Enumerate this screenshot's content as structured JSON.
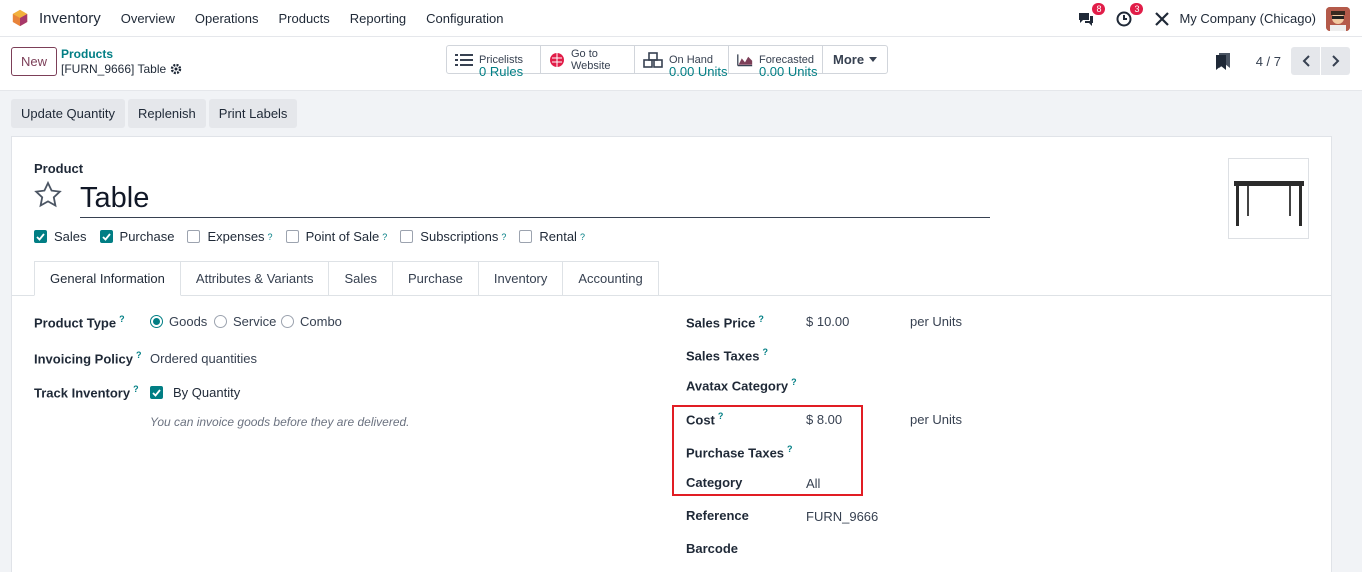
{
  "nav": {
    "app_name": "Inventory",
    "menu": [
      "Overview",
      "Operations",
      "Products",
      "Reporting",
      "Configuration"
    ],
    "chat_count": "8",
    "activity_count": "3",
    "company": "My Company (Chicago)"
  },
  "control": {
    "new_label": "New",
    "breadcrumb_parent": "Products",
    "breadcrumb_current": "[FURN_9666] Table",
    "smart_buttons": [
      {
        "line1": "Pricelists",
        "line2": "0 Rules"
      },
      {
        "line1": "Go to",
        "line2": "Website"
      },
      {
        "line1": "On Hand",
        "line2": "0.00 Units"
      },
      {
        "line1": "Forecasted",
        "line2": "0.00 Units"
      }
    ],
    "more_label": "More",
    "pager": "4 / 7"
  },
  "actions": [
    "Update Quantity",
    "Replenish",
    "Print Labels"
  ],
  "product": {
    "label": "Product",
    "name": "Table",
    "checks": [
      {
        "label": "Sales",
        "checked": true
      },
      {
        "label": "Purchase",
        "checked": true
      },
      {
        "label": "Expenses",
        "checked": false
      },
      {
        "label": "Point of Sale",
        "checked": false
      },
      {
        "label": "Subscriptions",
        "checked": false
      },
      {
        "label": "Rental",
        "checked": false
      }
    ]
  },
  "tabs": [
    "General Information",
    "Attributes & Variants",
    "Sales",
    "Purchase",
    "Inventory",
    "Accounting"
  ],
  "left_fields": {
    "product_type_label": "Product Type",
    "type_options": [
      "Goods",
      "Service",
      "Combo"
    ],
    "invoicing_label": "Invoicing Policy",
    "invoicing_value": "Ordered quantities",
    "track_label": "Track Inventory",
    "track_value": "By Quantity",
    "help_text": "You can invoice goods before they are delivered."
  },
  "right_fields": {
    "sales_price_label": "Sales Price",
    "sales_price_value": "$ 10.00",
    "sales_price_unit": "per Units",
    "sales_taxes_label": "Sales Taxes",
    "avatax_label": "Avatax Category",
    "cost_label": "Cost",
    "cost_value": "$ 8.00",
    "cost_unit": "per Units",
    "purchase_taxes_label": "Purchase Taxes",
    "category_label": "Category",
    "category_value": "All",
    "reference_label": "Reference",
    "reference_value": "FURN_9666",
    "barcode_label": "Barcode"
  },
  "colors": {
    "accent": "#017e84",
    "brand": "#7c3f58",
    "highlight": "#e11d24"
  }
}
